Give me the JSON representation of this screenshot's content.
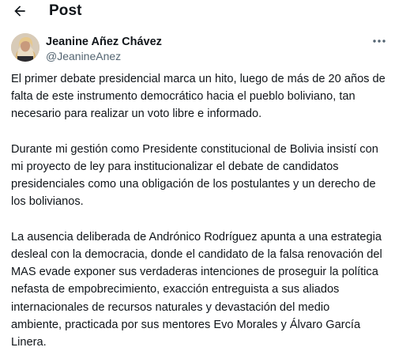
{
  "header": {
    "back_icon": "arrow-left-icon",
    "title": "Post"
  },
  "author": {
    "name": "Jeanine Añez Chávez",
    "handle": "@JeanineAnez",
    "avatar_icon": "profile-photo"
  },
  "more_icon": "more-horizontal-icon",
  "post": {
    "paragraphs": [
      "El primer debate presidencial marca un hito, luego de más de 20 años de\nfalta de este instrumento democrático hacia el pueblo boliviano, tan\nnecesario para realizar un voto libre e informado.",
      "Durante mi gestión como Presidente constitucional de Bolivia insistí con\nmi proyecto de ley para institucionalizar el debate de candidatos\npresidenciales como una obligación de los postulantes y un derecho de\nlos bolivianos.",
      "La ausencia deliberada de Andrónico Rodríguez apunta a una estrategia\ndesleal con la democracia, donde el candidato de la falsa renovación del\nMAS evade exponer sus verdaderas intenciones de proseguir la política\nnefasta de empobrecimiento, exacción entreguista a sus aliados\ninternacionales de recursos naturales y devastación del medio\nambiente, practicada por sus mentores Evo Morales y Álvaro García\nLinera."
    ]
  },
  "colors": {
    "text_primary": "#0f1419",
    "text_secondary": "#536471",
    "background": "#ffffff"
  }
}
